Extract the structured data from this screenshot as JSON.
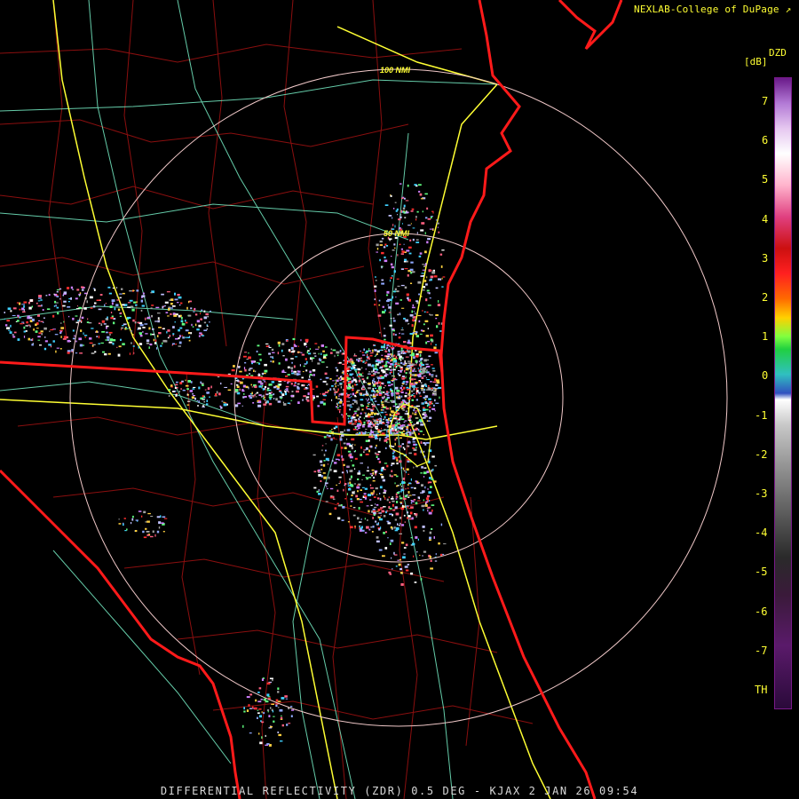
{
  "header": {
    "credit": "NEXLAB-College of DuPage"
  },
  "legend": {
    "product_code": "DZD",
    "unit": "[dB]",
    "ticks": [
      "7",
      "6",
      "5",
      "4",
      "3",
      "2",
      "1",
      "0",
      "-1",
      "-2",
      "-3",
      "-4",
      "-5",
      "-6",
      "-7",
      "TH"
    ]
  },
  "map": {
    "range_rings": [
      {
        "label": "50 NMI"
      },
      {
        "label": "100 NMI"
      }
    ]
  },
  "footer": {
    "caption": "DIFFERENTIAL REFLECTIVITY (ZDR) 0.5 DEG - KJAX 2 JAN 26 09:54"
  },
  "colors": {
    "background": "#000000",
    "text_yellow": "#ffff33",
    "coastline_red": "#ff1a1a",
    "county_lines": "#8b0f0f",
    "highways": "#ffff33",
    "roads": "#7fffd4",
    "range_ring": "#f0c8c8"
  }
}
